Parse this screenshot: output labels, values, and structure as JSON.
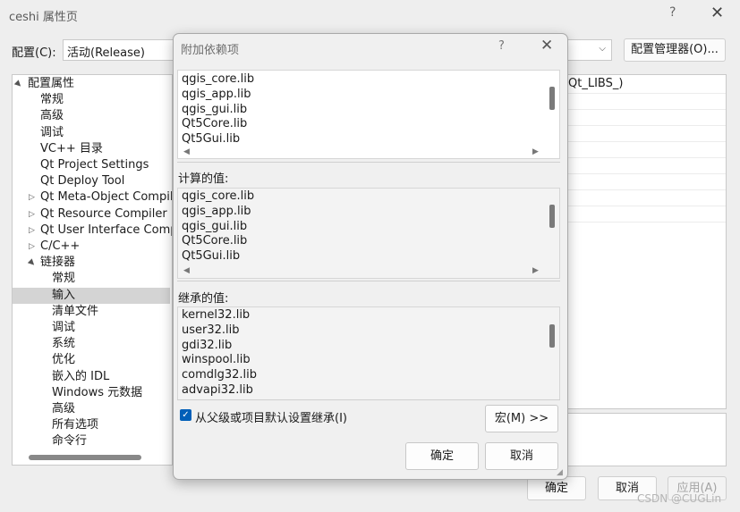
{
  "window": {
    "title": "ceshi 属性页",
    "help_icon": "?",
    "close_icon": "✕"
  },
  "config": {
    "label": "配置(C):",
    "value": "活动(Release)",
    "manager_button": "配置管理器(O)..."
  },
  "tree": {
    "items": [
      {
        "label": "配置属性",
        "level": 0,
        "expander": "▲"
      },
      {
        "label": "常规",
        "level": 1,
        "expander": ""
      },
      {
        "label": "高级",
        "level": 1,
        "expander": ""
      },
      {
        "label": "调试",
        "level": 1,
        "expander": ""
      },
      {
        "label": "VC++ 目录",
        "level": 1,
        "expander": ""
      },
      {
        "label": "Qt Project Settings",
        "level": 1,
        "expander": ""
      },
      {
        "label": "Qt Deploy Tool",
        "level": 1,
        "expander": ""
      },
      {
        "label": "Qt Meta-Object Compil",
        "level": 1,
        "expander": "▷"
      },
      {
        "label": "Qt Resource Compiler",
        "level": 1,
        "expander": "▷"
      },
      {
        "label": "Qt User Interface Compi",
        "level": 1,
        "expander": "▷"
      },
      {
        "label": "C/C++",
        "level": 1,
        "expander": "▷"
      },
      {
        "label": "链接器",
        "level": 1,
        "expander": "▲"
      },
      {
        "label": "常规",
        "level": 2,
        "expander": ""
      },
      {
        "label": "输入",
        "level": 2,
        "expander": "",
        "selected": true
      },
      {
        "label": "清单文件",
        "level": 2,
        "expander": ""
      },
      {
        "label": "调试",
        "level": 2,
        "expander": ""
      },
      {
        "label": "系统",
        "level": 2,
        "expander": ""
      },
      {
        "label": "优化",
        "level": 2,
        "expander": ""
      },
      {
        "label": "嵌入的 IDL",
        "level": 2,
        "expander": ""
      },
      {
        "label": "Windows 元数据",
        "level": 2,
        "expander": ""
      },
      {
        "label": "高级",
        "level": 2,
        "expander": ""
      },
      {
        "label": "所有选项",
        "level": 2,
        "expander": ""
      },
      {
        "label": "命令行",
        "level": 2,
        "expander": ""
      }
    ]
  },
  "grid": {
    "first_value": "Qt_LIBS_)"
  },
  "bottom_buttons": {
    "ok": "确定",
    "cancel": "取消",
    "apply": "应用(A)"
  },
  "watermark": "CSDN @CUGLin",
  "dialog": {
    "title": "附加依赖项",
    "help_icon": "?",
    "close_icon": "✕",
    "input_lines": [
      "qgis_core.lib",
      "qgis_app.lib",
      "qgis_gui.lib",
      "Qt5Core.lib",
      "Qt5Gui.lib"
    ],
    "computed_label": "计算的值:",
    "computed_lines": [
      "qgis_core.lib",
      "qgis_app.lib",
      "qgis_gui.lib",
      "Qt5Core.lib",
      "Qt5Gui.lib"
    ],
    "inherited_label": "继承的值:",
    "inherited_lines": [
      "kernel32.lib",
      "user32.lib",
      "gdi32.lib",
      "winspool.lib",
      "comdlg32.lib",
      "advapi32.lib"
    ],
    "inherit_checkbox_label": "从父级或项目默认设置继承(I)",
    "inherit_checked": true,
    "macro_button": "宏(M) >>",
    "ok_button": "确定",
    "cancel_button": "取消"
  }
}
